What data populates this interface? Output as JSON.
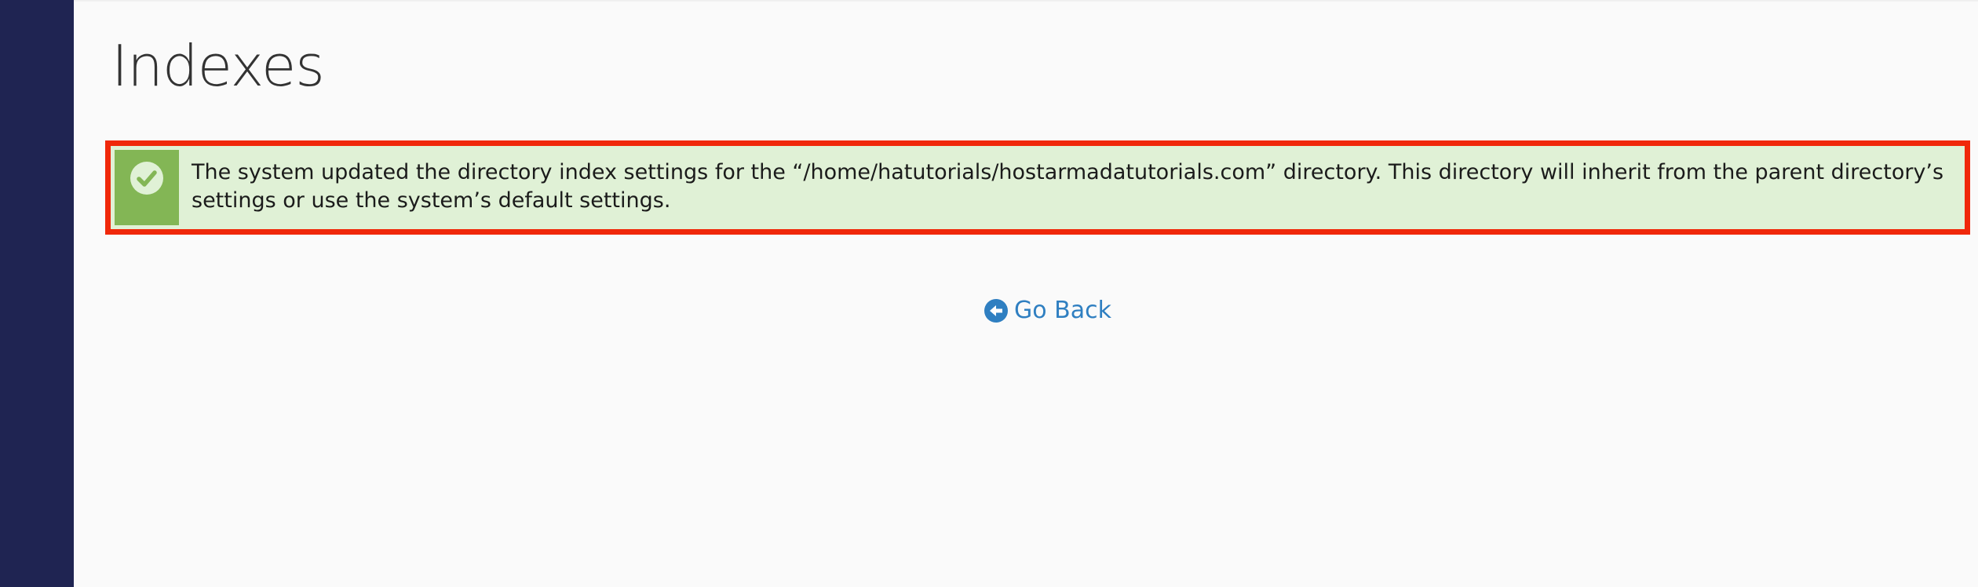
{
  "page": {
    "title": "Indexes"
  },
  "alert": {
    "type": "success",
    "icon": "check-circle-icon",
    "message": "The system updated the directory index settings for the “/home/hatutorials/hostarmadatutorials.com” directory. This directory will inherit from the parent directory’s settings or use the system’s default settings."
  },
  "actions": {
    "go_back_label": "Go Back",
    "go_back_icon": "arrow-circle-left-icon"
  },
  "colors": {
    "sidebar": "#1f2452",
    "success_bg": "#e0f1d6",
    "success_accent": "#83b655",
    "highlight_border": "#f0280a",
    "link": "#2f7fc1"
  }
}
